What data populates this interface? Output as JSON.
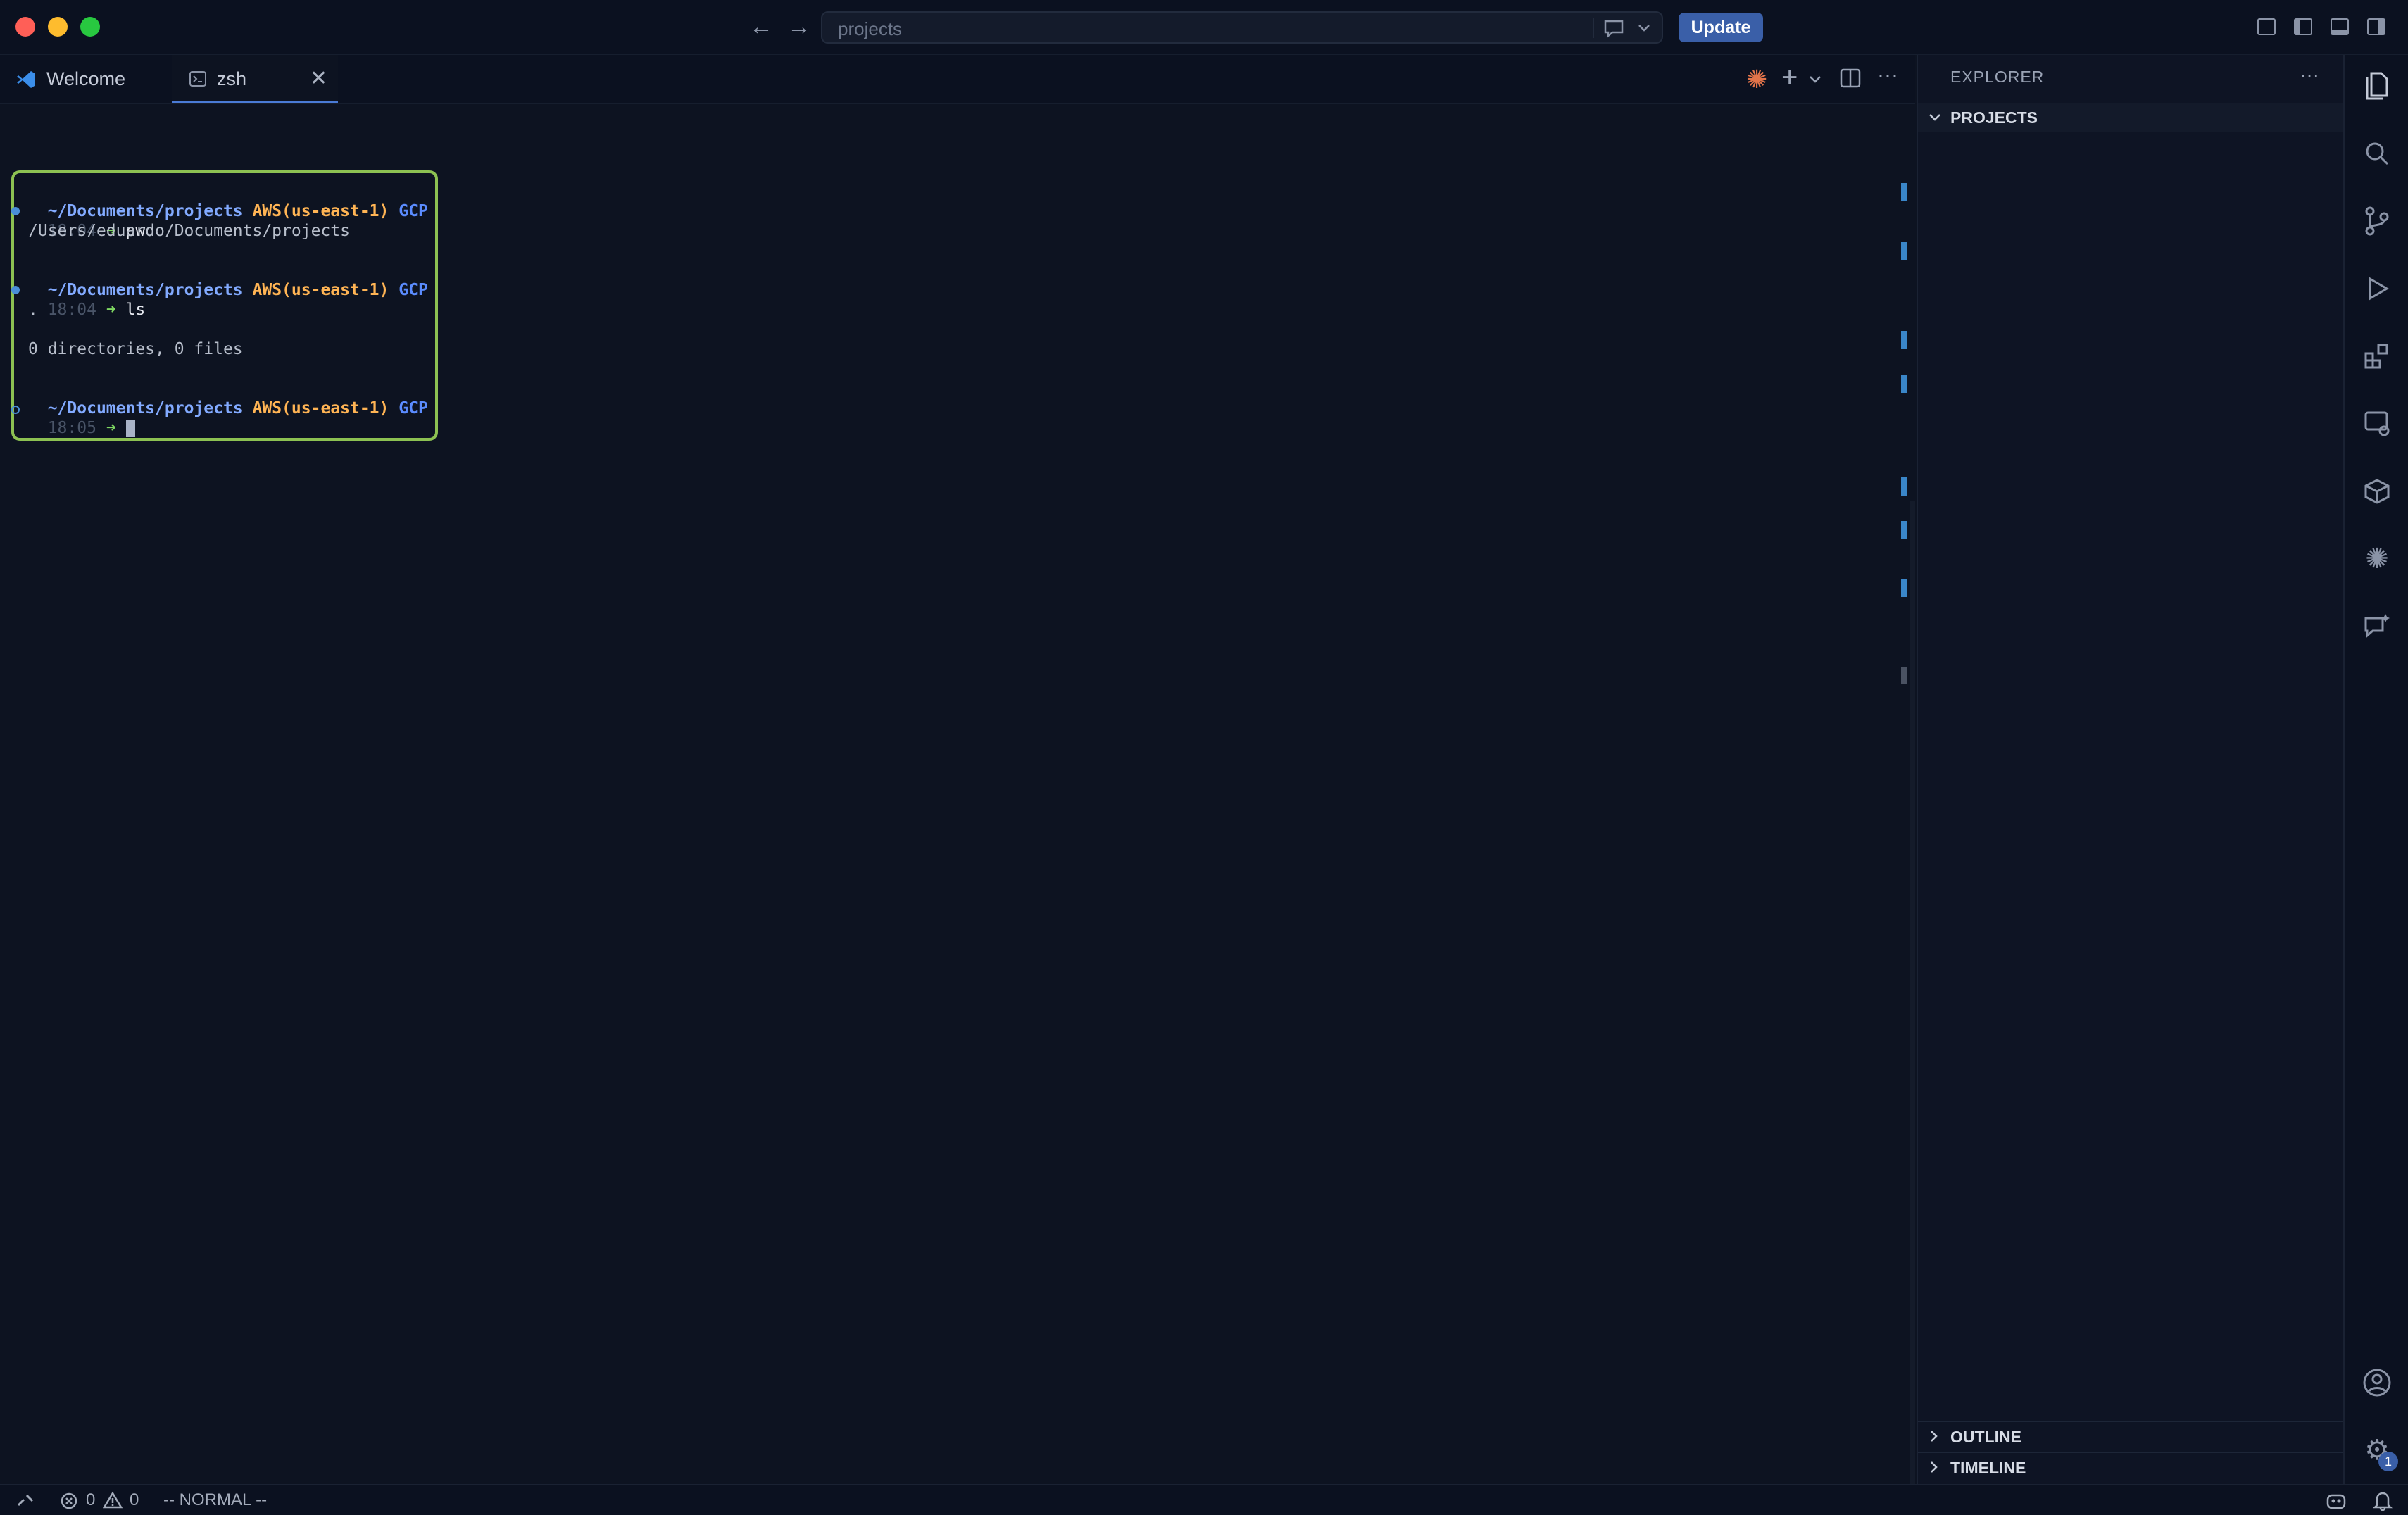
{
  "titlebar": {
    "search_placeholder": "projects",
    "update_label": "Update"
  },
  "tabs": [
    {
      "label": "Welcome"
    },
    {
      "label": "zsh"
    }
  ],
  "terminal": {
    "blocks": [
      {
        "path": "~/Documents/projects",
        "aws": "AWS(us-east-1)",
        "gcp": "GCP",
        "time": "18:04",
        "arrow": "➜",
        "cmd": "pwd"
      },
      {
        "path": "~/Documents/projects",
        "aws": "AWS(us-east-1)",
        "gcp": "GCP",
        "time": "18:04",
        "arrow": "➜",
        "cmd": "ls"
      },
      {
        "path": "~/Documents/projects",
        "aws": "AWS(us-east-1)",
        "gcp": "GCP",
        "time": "18:05",
        "arrow": "➜",
        "cmd": ""
      }
    ],
    "output_pwd": "/Users/eduardo/Documents/projects",
    "output_dot": ".",
    "output_summary": "0 directories, 0 files"
  },
  "sidebar": {
    "title": "EXPLORER",
    "more": "···",
    "folder": "PROJECTS",
    "outline": "OUTLINE",
    "timeline": "TIMELINE"
  },
  "statusbar": {
    "errors": "0",
    "warnings": "0",
    "mode": "-- NORMAL --"
  },
  "badges": {
    "settings_count": "1"
  },
  "colors": {
    "accent": "#3a5fa8",
    "terminal_border": "#8cc152",
    "aws": "#ffb454",
    "path": "#82aaff"
  }
}
